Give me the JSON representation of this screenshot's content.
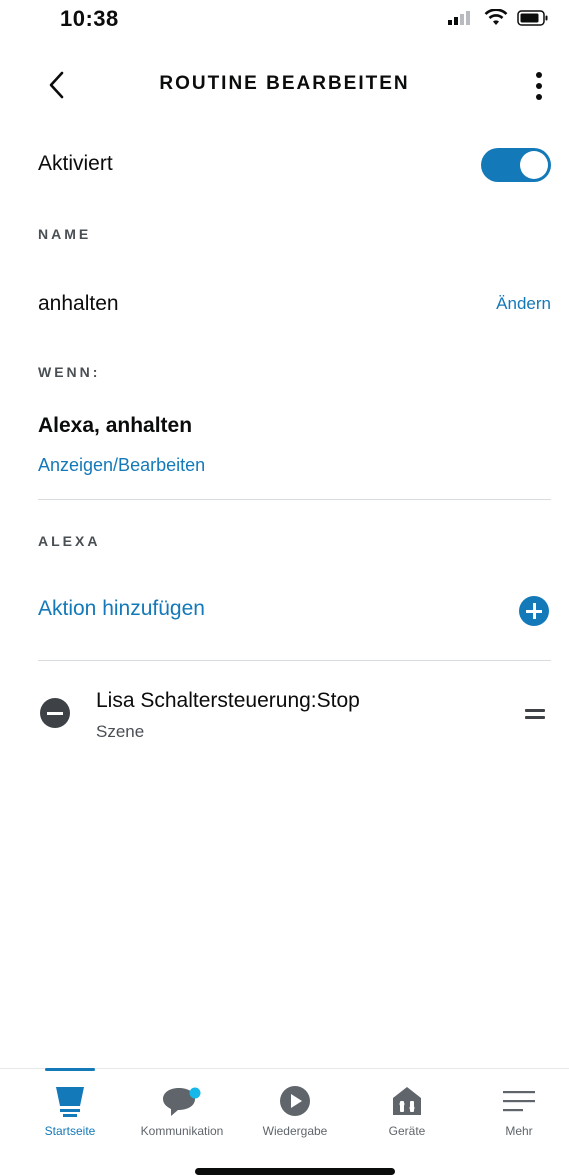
{
  "status_bar": {
    "time": "10:38"
  },
  "header": {
    "title": "ROUTINE BEARBEITEN"
  },
  "activated": {
    "label": "Aktiviert",
    "enabled": true
  },
  "name_section": {
    "label": "NAME",
    "value": "anhalten",
    "edit_link": "Ändern"
  },
  "when_section": {
    "label": "WENN:",
    "trigger": "Alexa, anhalten",
    "view_edit_link": "Anzeigen/Bearbeiten"
  },
  "alexa_section": {
    "label": "ALEXA",
    "add_action": "Aktion hinzufügen",
    "actions": [
      {
        "title": "Lisa  Schaltersteuerung:Stop",
        "subtitle": "Szene"
      }
    ]
  },
  "tabs": [
    {
      "label": "Startseite",
      "icon": "home-icon",
      "active": true
    },
    {
      "label": "Kommunikation",
      "icon": "chat-bubble-icon",
      "active": false
    },
    {
      "label": "Wiedergabe",
      "icon": "play-icon",
      "active": false
    },
    {
      "label": "Geräte",
      "icon": "devices-icon",
      "active": false
    },
    {
      "label": "Mehr",
      "icon": "menu-icon",
      "active": false
    }
  ],
  "colors": {
    "accent": "#1479b8",
    "text": "#0b0c0c",
    "muted": "#4a4f54",
    "notification_dot": "#15b8e8"
  }
}
